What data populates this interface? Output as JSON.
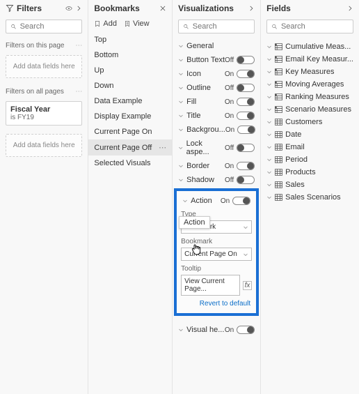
{
  "filters": {
    "title": "Filters",
    "search_placeholder": "Search",
    "section_page": "Filters on this page",
    "section_all": "Filters on all pages",
    "drop_hint": "Add data fields here",
    "fiscal_field": "Fiscal Year",
    "fiscal_value": "is FY19"
  },
  "bookmarks": {
    "title": "Bookmarks",
    "add_label": "Add",
    "view_label": "View",
    "items": [
      "Top",
      "Bottom",
      "Up",
      "Down",
      "Data Example",
      "Display Example",
      "Current Page On",
      "Current Page Off",
      "Selected Visuals"
    ],
    "selected_index": 7
  },
  "viz": {
    "title": "Visualizations",
    "search_placeholder": "Search",
    "tooltip_float": "Action",
    "props": [
      {
        "label": "General",
        "toggle": null
      },
      {
        "label": "Button Text",
        "toggle": "Off"
      },
      {
        "label": "Icon",
        "toggle": "On"
      },
      {
        "label": "Outline",
        "toggle": "Off"
      },
      {
        "label": "Fill",
        "toggle": "On"
      },
      {
        "label": "Title",
        "toggle": "On"
      },
      {
        "label": "Backgrou...",
        "toggle": "On"
      },
      {
        "label": "Lock aspe...",
        "toggle": "Off"
      },
      {
        "label": "Border",
        "toggle": "On"
      },
      {
        "label": "Shadow",
        "toggle": "Off"
      }
    ],
    "action": {
      "label": "Action",
      "toggle": "On",
      "type_label": "Type",
      "type_value": "Bookmark",
      "bookmark_label": "Bookmark",
      "bookmark_value": "Current Page On",
      "tooltip_label": "Tooltip",
      "tooltip_value": "View Current Page...",
      "fx": "fx",
      "revert": "Revert to default"
    },
    "visual_header": {
      "label": "Visual he...",
      "toggle": "On"
    }
  },
  "fields": {
    "title": "Fields",
    "search_placeholder": "Search",
    "items": [
      {
        "label": "Cumulative Meas...",
        "type": "measure"
      },
      {
        "label": "Email Key Measur...",
        "type": "measure"
      },
      {
        "label": "Key Measures",
        "type": "measure"
      },
      {
        "label": "Moving Averages",
        "type": "measure"
      },
      {
        "label": "Ranking Measures",
        "type": "measure"
      },
      {
        "label": "Scenario Measures",
        "type": "measure"
      },
      {
        "label": "Customers",
        "type": "table"
      },
      {
        "label": "Date",
        "type": "table"
      },
      {
        "label": "Email",
        "type": "table"
      },
      {
        "label": "Period",
        "type": "table"
      },
      {
        "label": "Products",
        "type": "table"
      },
      {
        "label": "Sales",
        "type": "table"
      },
      {
        "label": "Sales Scenarios",
        "type": "table",
        "expanded": true
      }
    ]
  }
}
